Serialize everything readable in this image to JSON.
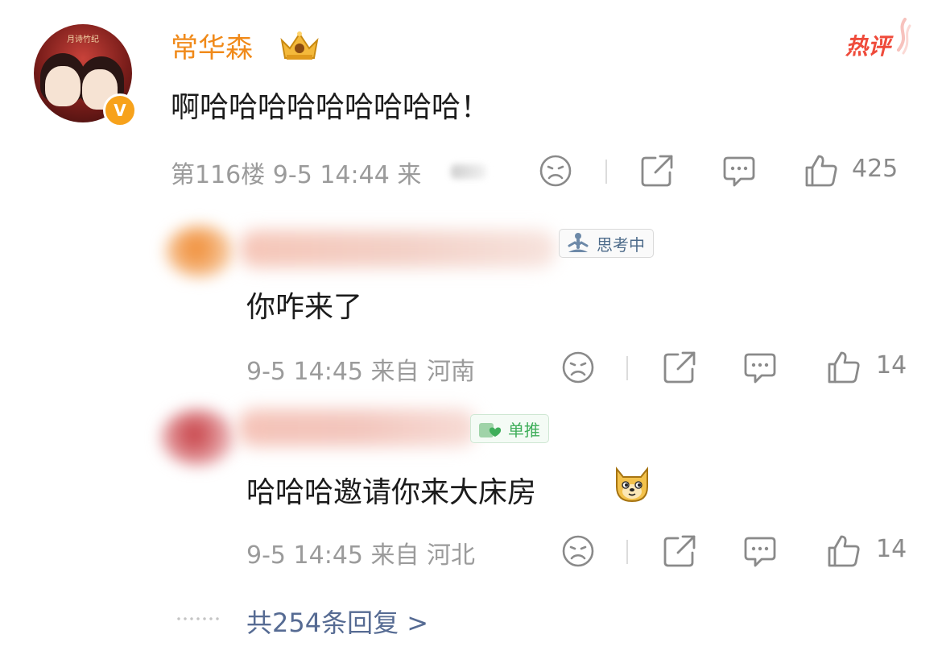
{
  "main_comment": {
    "avatar_caption": "月诗竹纪",
    "username": "常华森",
    "hot_badge": "热评",
    "text": "啊哈哈哈哈哈哈哈哈哈！",
    "meta": "第116楼 9-5 14:44 来",
    "like_count": "425"
  },
  "replies": [
    {
      "tag": "思考中",
      "text": "你咋来了",
      "meta": "9-5 14:45 来自 河南",
      "like_count": "14"
    },
    {
      "tag": "单推",
      "text": "哈哈哈邀请你来大床房",
      "meta": "9-5 14:45 来自 河北",
      "like_count": "14"
    }
  ],
  "more_replies": "共254条回复 >",
  "colors": {
    "username": "#f08a1a",
    "hot": "#ef4b3b",
    "meta": "#9b9b9b",
    "link": "#566b93",
    "verified": "#f7a21b",
    "tag_thinking": "#4d6b8a",
    "tag_single": "#3fae5a"
  },
  "icons": [
    "crown-icon",
    "sad-face-icon",
    "share-icon",
    "comment-icon",
    "thumbs-up-icon",
    "meditate-icon",
    "doge-emoji-icon"
  ]
}
